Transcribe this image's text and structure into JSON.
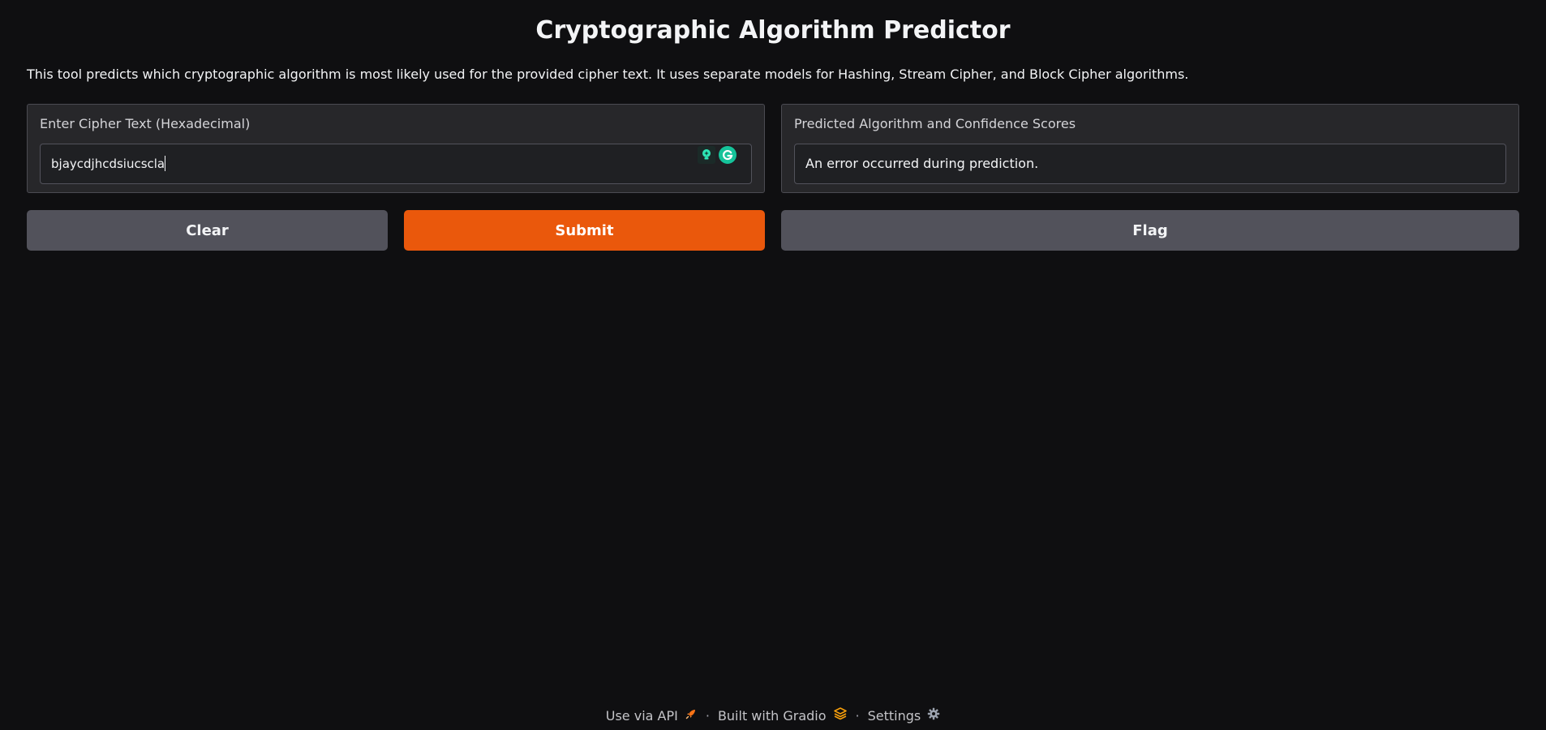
{
  "header": {
    "title": "Cryptographic Algorithm Predictor",
    "description": "This tool predicts which cryptographic algorithm is most likely used for the provided cipher text. It uses separate models for Hashing, Stream Cipher, and Block Cipher algorithms."
  },
  "input_panel": {
    "label": "Enter Cipher Text (Hexadecimal)",
    "value": "bjaycdjhcdsiucscla"
  },
  "output_panel": {
    "label": "Predicted Algorithm and Confidence Scores",
    "value": "An error occurred during prediction."
  },
  "buttons": {
    "clear": "Clear",
    "submit": "Submit",
    "flag": "Flag"
  },
  "footer": {
    "api": "Use via API",
    "built_with": "Built with Gradio",
    "settings": "Settings",
    "separator": "·"
  },
  "colors": {
    "background": "#0f0f11",
    "panel": "#27272a",
    "accent": "#ea580c",
    "secondary_button": "#52525b"
  },
  "icons": {
    "api": "rocket-icon",
    "gradio": "gradio-logo-icon",
    "settings": "gear-icon",
    "grammarly": "grammarly-icon",
    "extension": "lightbulb-icon"
  }
}
